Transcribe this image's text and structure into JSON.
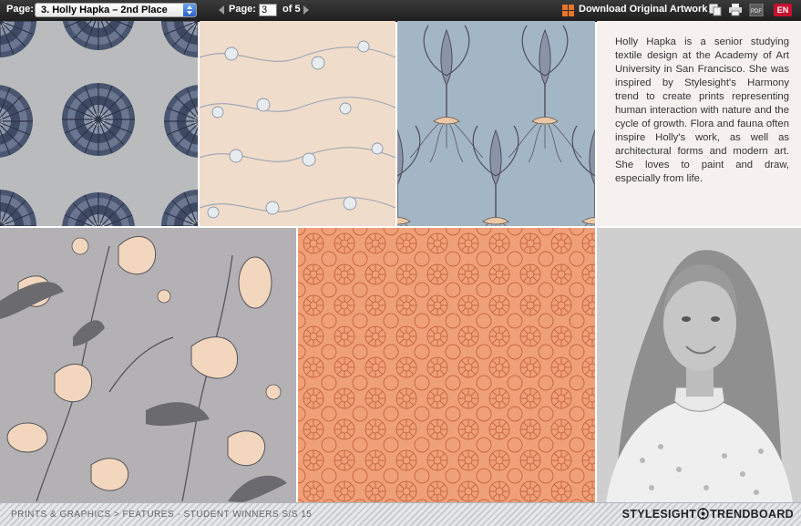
{
  "toolbar": {
    "page_label": "Page:",
    "page_select_value": "3. Holly Hapka – 2nd Place",
    "page_label2": "Page:",
    "page_input_value": "3",
    "page_of": "of 5",
    "download_label": "Download Original Artwork",
    "icons": [
      "grid-icon",
      "copy-icon",
      "print-icon",
      "pdf-icon"
    ],
    "pdf_text": "PDF",
    "language": "EN",
    "colors": {
      "bar": "#2a2a2a",
      "select_button": "#2a62c8",
      "download_icon": "#e8742a",
      "language_badge": "#c8102e"
    }
  },
  "panels": {
    "tile_1": {
      "name": "tree-crown-pattern",
      "bg": "#b9bbbd",
      "ink": "#3e4a63"
    },
    "tile_2": {
      "name": "peach-floral-vine-pattern",
      "bg": "#f0dccb",
      "ink": "#9aa3b2"
    },
    "tile_3": {
      "name": "blue-iris-root-pattern",
      "bg": "#a3b6c6",
      "ink": "#5a5560",
      "accent": "#e9c8a8"
    },
    "tile_4": {
      "name": "gray-botanical-pattern",
      "bg": "#b3b1b4",
      "ink": "#55555a",
      "accent": "#f2d6bd"
    },
    "tile_5": {
      "name": "orange-daisy-pattern",
      "bg": "#f0a079",
      "ink": "#c9683f"
    },
    "portrait": {
      "name": "designer-portrait-photo"
    }
  },
  "bio": {
    "text": "Holly Hapka is a senior studying textile design at the Academy of Art University in San Francisco. She was inspired by Stylesight's Harmony trend to create prints representing human interaction with nature and the cycle of growth. Flora and fauna often inspire Holly's work, as well as architectural forms and modern art. She loves to paint and draw, especially from life."
  },
  "footer": {
    "breadcrumb": "PRINTS & GRAPHICS > FEATURES - STUDENT WINNERS S/S 15",
    "brand_left": "STYLESIGHT",
    "brand_right": "TRENDBOARD"
  }
}
